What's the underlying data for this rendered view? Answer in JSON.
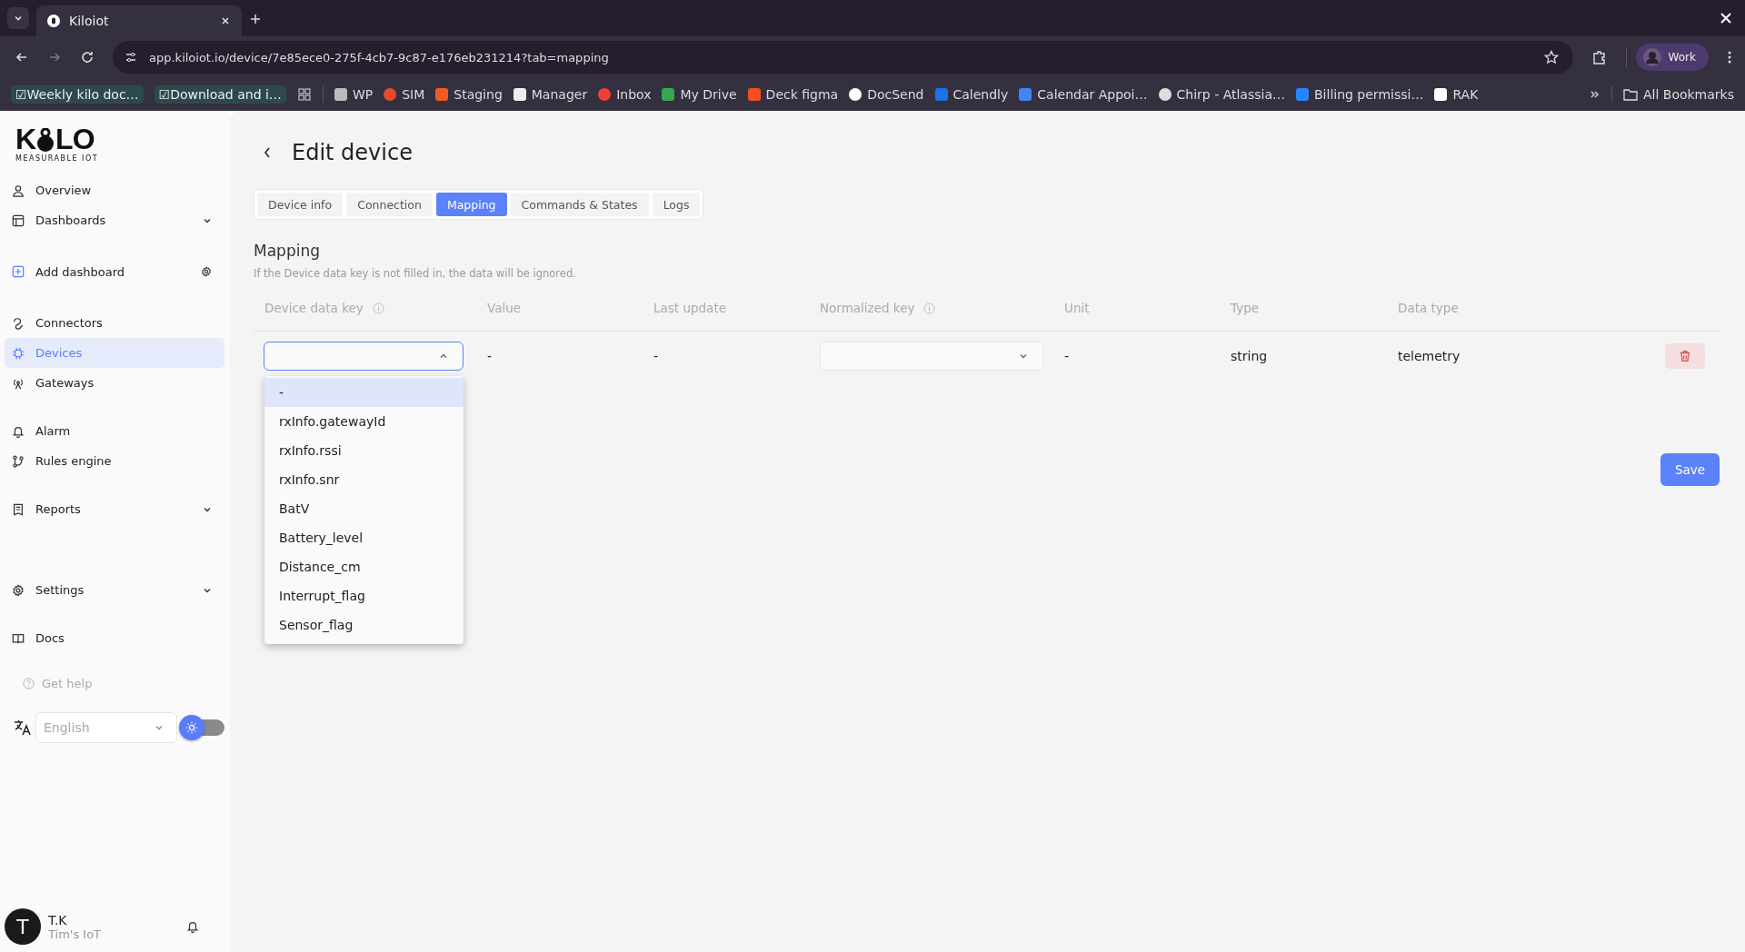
{
  "browser": {
    "tab_title": "Kiloiot",
    "url": "app.kiloiot.io/device/7e85ece0-275f-4cb7-9c87-e176eb231214?tab=mapping",
    "profile": "Work",
    "bookmarks": [
      {
        "label": "☑Weekly kilo doc…",
        "kind": "pill"
      },
      {
        "label": "☑Download and i…",
        "kind": "pill"
      },
      {
        "label": "WP",
        "kind": "link"
      },
      {
        "label": "SIM",
        "kind": "link"
      },
      {
        "label": "Staging",
        "kind": "link"
      },
      {
        "label": "Manager",
        "kind": "link"
      },
      {
        "label": "Inbox",
        "kind": "link"
      },
      {
        "label": "My Drive",
        "kind": "link"
      },
      {
        "label": "Deck figma",
        "kind": "link"
      },
      {
        "label": "DocSend",
        "kind": "link"
      },
      {
        "label": "Calendly",
        "kind": "link"
      },
      {
        "label": "Calendar Appoi…",
        "kind": "link"
      },
      {
        "label": "Chirp - Atlassia…",
        "kind": "link"
      },
      {
        "label": "Billing permissi…",
        "kind": "link"
      },
      {
        "label": "RAK",
        "kind": "link"
      }
    ],
    "all_bookmarks": "All Bookmarks"
  },
  "logo": {
    "left": "K",
    "right": "LO",
    "tagline": "MEASURABLE IOT"
  },
  "sidebar": {
    "sections": [
      [
        {
          "label": "Overview",
          "kind": "link",
          "selected": false
        },
        {
          "label": "Dashboards",
          "kind": "group",
          "selected": false
        }
      ],
      [
        {
          "label": "Add dashboard",
          "kind": "action",
          "selected": false
        }
      ],
      [
        {
          "label": "Connectors",
          "kind": "link",
          "selected": false
        },
        {
          "label": "Devices",
          "kind": "link",
          "selected": true
        },
        {
          "label": "Gateways",
          "kind": "link",
          "selected": false
        }
      ],
      [
        {
          "label": "Alarm",
          "kind": "link",
          "selected": false
        },
        {
          "label": "Rules engine",
          "kind": "link",
          "selected": false
        }
      ],
      [
        {
          "label": "Reports",
          "kind": "group",
          "selected": false
        }
      ],
      [
        {
          "label": "Settings",
          "kind": "group",
          "selected": false
        }
      ],
      [
        {
          "label": "Docs",
          "kind": "link",
          "selected": false
        }
      ]
    ],
    "help": "Get help",
    "language": "English",
    "dark_mode": false,
    "user": {
      "initial": "T",
      "name": "T.K",
      "org": "Tim's IoT"
    }
  },
  "page": {
    "title": "Edit device",
    "tabs": [
      {
        "label": "Device info",
        "selected": false
      },
      {
        "label": "Connection",
        "selected": false
      },
      {
        "label": "Mapping",
        "selected": true
      },
      {
        "label": "Commands & States",
        "selected": false
      },
      {
        "label": "Logs",
        "selected": false
      }
    ],
    "section_title": "Mapping",
    "hint": "If the Device data key is not filled in, the data will be ignored.",
    "columns": [
      {
        "label": "Device data key",
        "info": true
      },
      {
        "label": "Value",
        "info": false
      },
      {
        "label": "Last update",
        "info": false
      },
      {
        "label": "Normalized key",
        "info": true
      },
      {
        "label": "Unit",
        "info": false
      },
      {
        "label": "Type",
        "info": false
      },
      {
        "label": "Data type",
        "info": false
      }
    ],
    "row": {
      "value": "-",
      "last_update": "-",
      "unit": "-",
      "type": "string",
      "data_type": "telemetry"
    },
    "dropdown": {
      "expanded": true,
      "options": [
        {
          "label": "-",
          "selected": true
        },
        {
          "label": "rxInfo.gatewayId",
          "selected": false
        },
        {
          "label": "rxInfo.rssi",
          "selected": false
        },
        {
          "label": "rxInfo.snr",
          "selected": false
        },
        {
          "label": "BatV",
          "selected": false
        },
        {
          "label": "Battery_level",
          "selected": false
        },
        {
          "label": "Distance_cm",
          "selected": false
        },
        {
          "label": "Interrupt_flag",
          "selected": false
        },
        {
          "label": "Sensor_flag",
          "selected": false
        }
      ]
    },
    "save": "Save"
  }
}
